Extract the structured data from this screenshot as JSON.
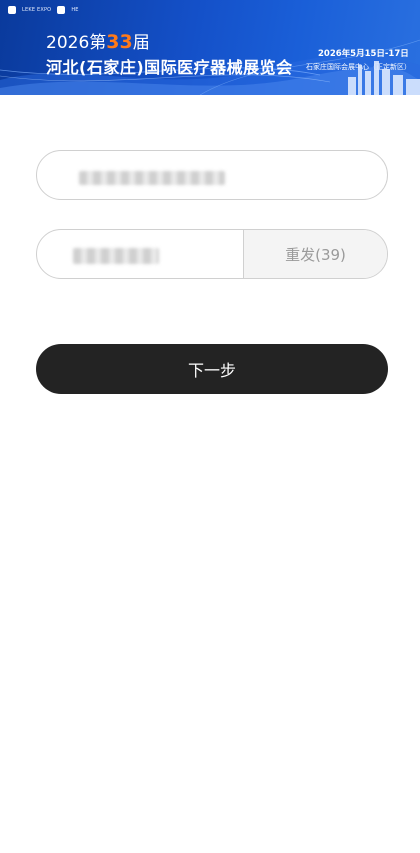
{
  "banner": {
    "logo_left": "LEKE EXPO",
    "logo_right": "HE",
    "year_prefix": "2026第",
    "edition": "33",
    "year_suffix": "届",
    "title": "河北(石家庄)国际医疗器械展览会",
    "date": "2026年5月15日-17日",
    "venue": "石家庄国际会展中心（正定新区）"
  },
  "form": {
    "phone_value": "",
    "phone_placeholder": "",
    "code_value": "",
    "code_placeholder": "",
    "resend_label": "重发(39)",
    "next_label": "下一步"
  },
  "colors": {
    "banner": "#1450c8",
    "accent_orange": "#ff7a1a",
    "button_dark": "#232323",
    "border": "#d0d0d0"
  }
}
